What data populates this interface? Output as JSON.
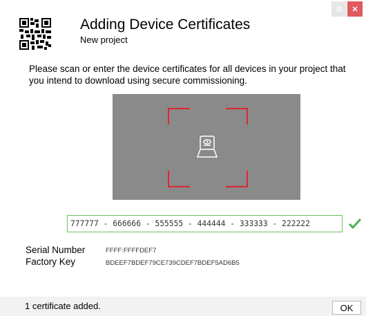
{
  "window": {
    "settings_icon": "gear-icon",
    "close_icon": "close-icon",
    "close_glyph": "✕",
    "settings_glyph": "⚙"
  },
  "header": {
    "title": "Adding Device Certificates",
    "subtitle": "New project",
    "icon": "qr-code-icon"
  },
  "instructions": "Please scan or enter the device certificates for all devices in your project that you intend to download using secure commissioning.",
  "scanner": {
    "icon": "webcam-icon",
    "frame_color": "#e1252f",
    "background": "#8a8a8a"
  },
  "certificate_input": {
    "value": "777777 - 666666 - 555555 - 444444 - 333333 - 222222",
    "valid": true,
    "accent": "#6cbf63"
  },
  "device_info": {
    "serial_label": "Serial Number",
    "serial_value": "FFFF:FFFFDEF7",
    "key_label": "Factory Key",
    "key_value": "BDEEF7BDEF79CE739CDEF7BDEF5AD6B5"
  },
  "status": {
    "text": "1 certificate added.",
    "ok_label": "OK"
  },
  "colors": {
    "close_button": "#e05a5f",
    "valid_check": "#4caf50"
  }
}
